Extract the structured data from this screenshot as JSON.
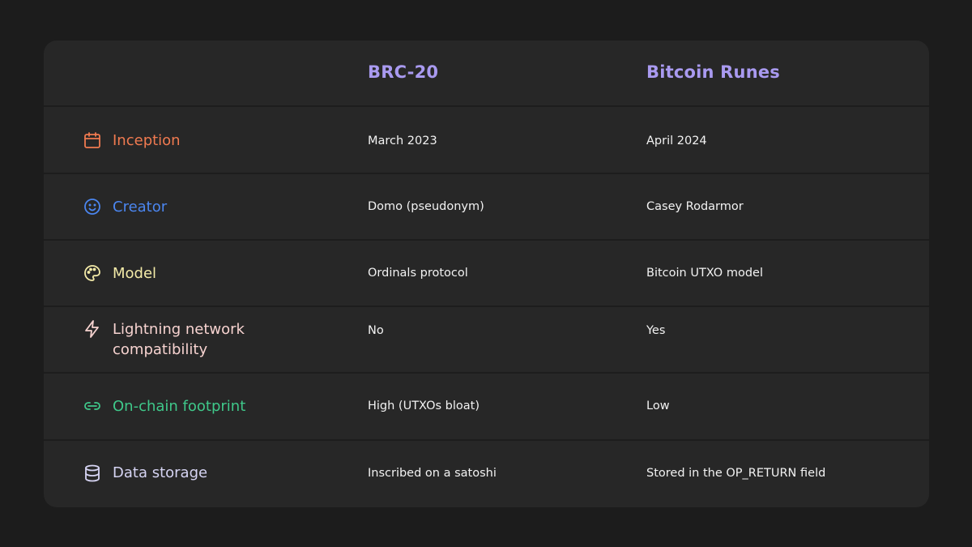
{
  "columns": {
    "col1": "BRC-20",
    "col2": "Bitcoin Runes"
  },
  "colors": {
    "header": "#a99af0",
    "inception": "#f07a50",
    "creator": "#4b86f0",
    "model": "#f4eba8",
    "lightning": "#f7d3d0",
    "footprint": "#3fc88a",
    "storage": "#d6d4f3"
  },
  "rows": [
    {
      "label": "Inception",
      "icon": "calendar-icon",
      "brc20": "March 2023",
      "runes": "April 2024"
    },
    {
      "label": "Creator",
      "icon": "smiley-icon",
      "brc20": "Domo (pseudonym)",
      "runes": "Casey Rodarmor"
    },
    {
      "label": "Model",
      "icon": "palette-icon",
      "brc20": "Ordinals protocol",
      "runes": "Bitcoin UTXO model"
    },
    {
      "label_line1": "Lightning network",
      "label_line2": "compatibility",
      "icon": "lightning-bolt-icon",
      "brc20": "No",
      "runes": "Yes"
    },
    {
      "label": "On-chain footprint",
      "icon": "link-icon",
      "brc20": "High (UTXOs bloat)",
      "runes": "Low"
    },
    {
      "label": "Data storage",
      "icon": "database-icon",
      "brc20": "Inscribed on a satoshi",
      "runes": "Stored in the OP_RETURN field"
    }
  ]
}
